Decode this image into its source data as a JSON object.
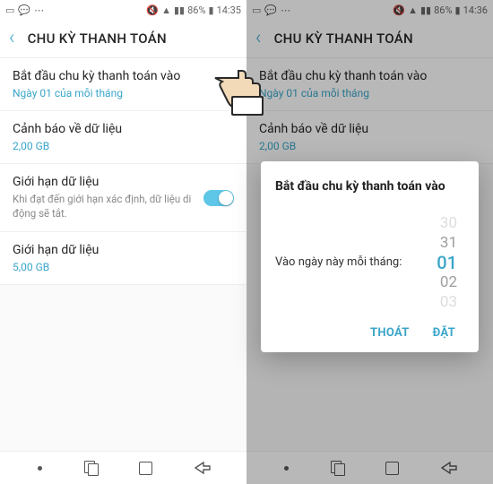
{
  "left": {
    "statusbar": {
      "battery": "86%",
      "time": "14:35"
    },
    "header": {
      "title": "CHU KỲ THANH TOÁN"
    },
    "rows": {
      "billing": {
        "title": "Bắt đầu chu kỳ thanh toán vào",
        "sub": "Ngày 01 của mỗi tháng"
      },
      "warning": {
        "title": "Cảnh báo về dữ liệu",
        "sub": "2,00 GB"
      },
      "limit_toggle": {
        "title": "Giới hạn dữ liệu",
        "desc": "Khi đạt đến giới hạn xác định, dữ liệu di động sẽ tắt."
      },
      "limit_value": {
        "title": "Giới hạn dữ liệu",
        "sub": "5,00 GB"
      }
    }
  },
  "right": {
    "statusbar": {
      "battery": "86%",
      "time": "14:36"
    },
    "header": {
      "title": "CHU KỲ THANH TOÁN"
    },
    "rows": {
      "billing": {
        "title": "Bắt đầu chu kỳ thanh toán vào",
        "sub": "Ngày 01 của mỗi tháng"
      },
      "warning": {
        "title": "Cảnh báo về dữ liệu",
        "sub": "2,00 GB"
      }
    },
    "dialog": {
      "title": "Bắt đầu chu kỳ thanh toán vào",
      "label": "Vào ngày này mỗi tháng:",
      "wheel": {
        "far_above": "30",
        "above": "31",
        "selected": "01",
        "below": "02",
        "far_below": "03"
      },
      "cancel": "THOÁT",
      "ok": "ĐẶT"
    }
  }
}
